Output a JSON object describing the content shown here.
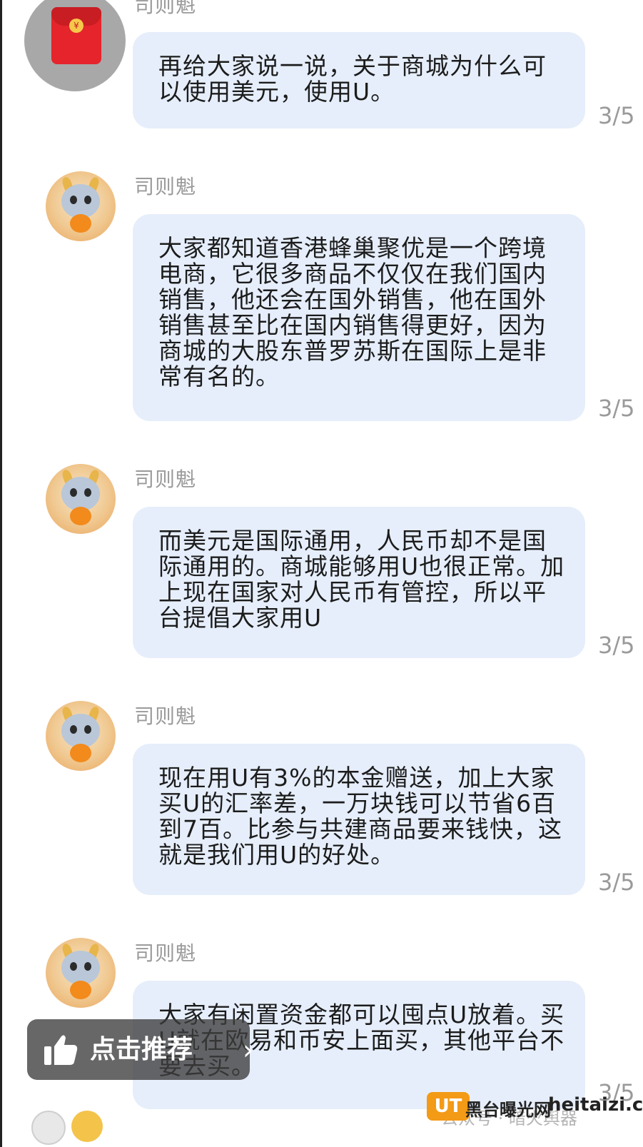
{
  "sender_name": "司则魁",
  "messages": [
    {
      "lines": [
        "再给大家说一说，关于商城为什么可",
        "以使用美元，使用U。"
      ],
      "time": "3/5"
    },
    {
      "lines": [
        "大家都知道香港蜂巢聚优是一个跨境",
        "电商，它很多商品不仅仅在我们国内",
        "销售，他还会在国外销售，他在国外",
        "销售甚至比在国内销售得更好，因为",
        "商城的大股东普罗苏斯在国际上是非",
        "常有名的。"
      ],
      "time": "3/5"
    },
    {
      "lines": [
        "而美元是国际通用，人民币却不是国",
        "际通用的。商城能够用U也很正常。加",
        "上现在国家对人民币有管控，所以平",
        "台提倡大家用U"
      ],
      "time": "3/5"
    },
    {
      "lines": [
        "现在用U有3%的本金赠送，加上大家",
        "买U的汇率差，一万块钱可以节省6百",
        "到7百。比参与共建商品要来钱快，这",
        "就是我们用U的好处。"
      ],
      "time": "3/5"
    },
    {
      "lines": [
        "大家有闲置资金都可以囤点U放着。买",
        "U就在欧易和币安上面买，其他平台不",
        "要去买。"
      ],
      "time": "3/5"
    }
  ],
  "recommend_button": {
    "label": "点击推荐",
    "chevron": "›"
  },
  "watermark": {
    "account": "公众号 · 暗火舆器",
    "logo": "UT",
    "site_cn": "黑台曝光网",
    "site_en": "heitaizi.com"
  },
  "icons": {
    "red_packet": "red-packet-icon",
    "yen": "¥",
    "thumb": "thumbs-up-icon"
  },
  "colors": {
    "bubble": "#e6eefb",
    "name": "#9a9a9a",
    "accent": "#f39a16"
  }
}
